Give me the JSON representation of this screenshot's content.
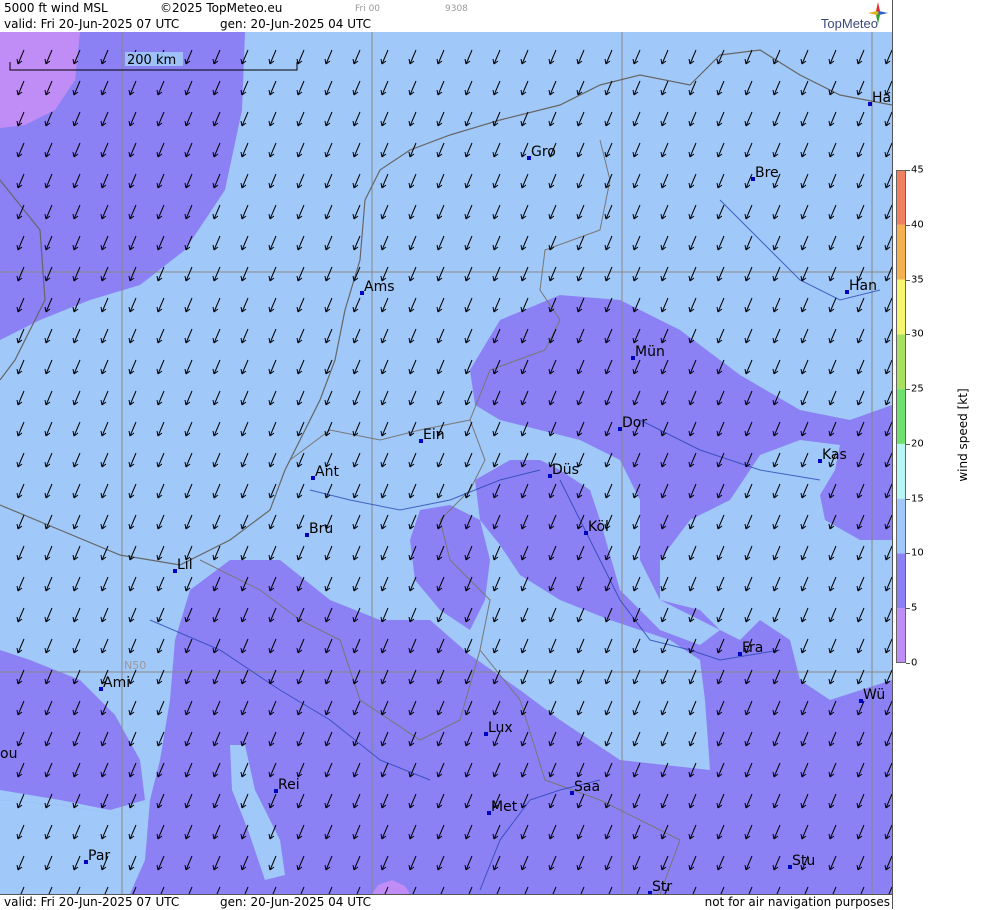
{
  "header": {
    "product": "5000 ft wind MSL",
    "copyright": "©2025 TopMeteo.eu",
    "valid": "valid:  Fri  20-Jun-2025  07 UTC",
    "generated": "gen: 20-Jun-2025 04 UTC",
    "small_time": "Fri 00",
    "small_code": "9308",
    "brand": "TopMeteo"
  },
  "footer": {
    "valid": "valid:  Fri  20-Jun-2025  07 UTC",
    "generated": "gen: 20-Jun-2025 04 UTC",
    "disclaimer": "not for air navigation purposes"
  },
  "scale_bar": {
    "label": "200 km"
  },
  "grid_label": "N50",
  "cities": [
    {
      "name": "Ha"
    },
    {
      "name": "Gro"
    },
    {
      "name": "Bre"
    },
    {
      "name": "Ams"
    },
    {
      "name": "Han"
    },
    {
      "name": "Mün"
    },
    {
      "name": "Dor"
    },
    {
      "name": "Ein"
    },
    {
      "name": "Kas"
    },
    {
      "name": "Düs"
    },
    {
      "name": "Ant"
    },
    {
      "name": "Köl"
    },
    {
      "name": "Bru"
    },
    {
      "name": "Lil"
    },
    {
      "name": "Fra"
    },
    {
      "name": "Ami"
    },
    {
      "name": "Wü"
    },
    {
      "name": "ou"
    },
    {
      "name": "Lux"
    },
    {
      "name": "Rei"
    },
    {
      "name": "Saa"
    },
    {
      "name": "Met"
    },
    {
      "name": "Par"
    },
    {
      "name": "Stu"
    },
    {
      "name": "Str"
    }
  ],
  "legend": {
    "unit": "wind  speed  [kt]",
    "ticks": [
      "45",
      "40",
      "35",
      "30",
      "25",
      "20",
      "15",
      "10",
      "5",
      "0"
    ],
    "bands": [
      {
        "from": 0,
        "to": 5,
        "color": "#c08cf5"
      },
      {
        "from": 5,
        "to": 10,
        "color": "#8c80f5"
      },
      {
        "from": 10,
        "to": 15,
        "color": "#a0c8f8"
      },
      {
        "from": 15,
        "to": 20,
        "color": "#b8f5f5"
      },
      {
        "from": 20,
        "to": 25,
        "color": "#6de06d"
      },
      {
        "from": 25,
        "to": 30,
        "color": "#a8e060"
      },
      {
        "from": 30,
        "to": 35,
        "color": "#f5f570"
      },
      {
        "from": 35,
        "to": 40,
        "color": "#f5b050"
      },
      {
        "from": 40,
        "to": 45,
        "color": "#f08060"
      }
    ]
  },
  "colors": {
    "light_wind": "#a0c8f8",
    "medium_wind": "#8c80f5",
    "weak_wind": "#c08cf5",
    "city_marker": "#0000c0"
  }
}
